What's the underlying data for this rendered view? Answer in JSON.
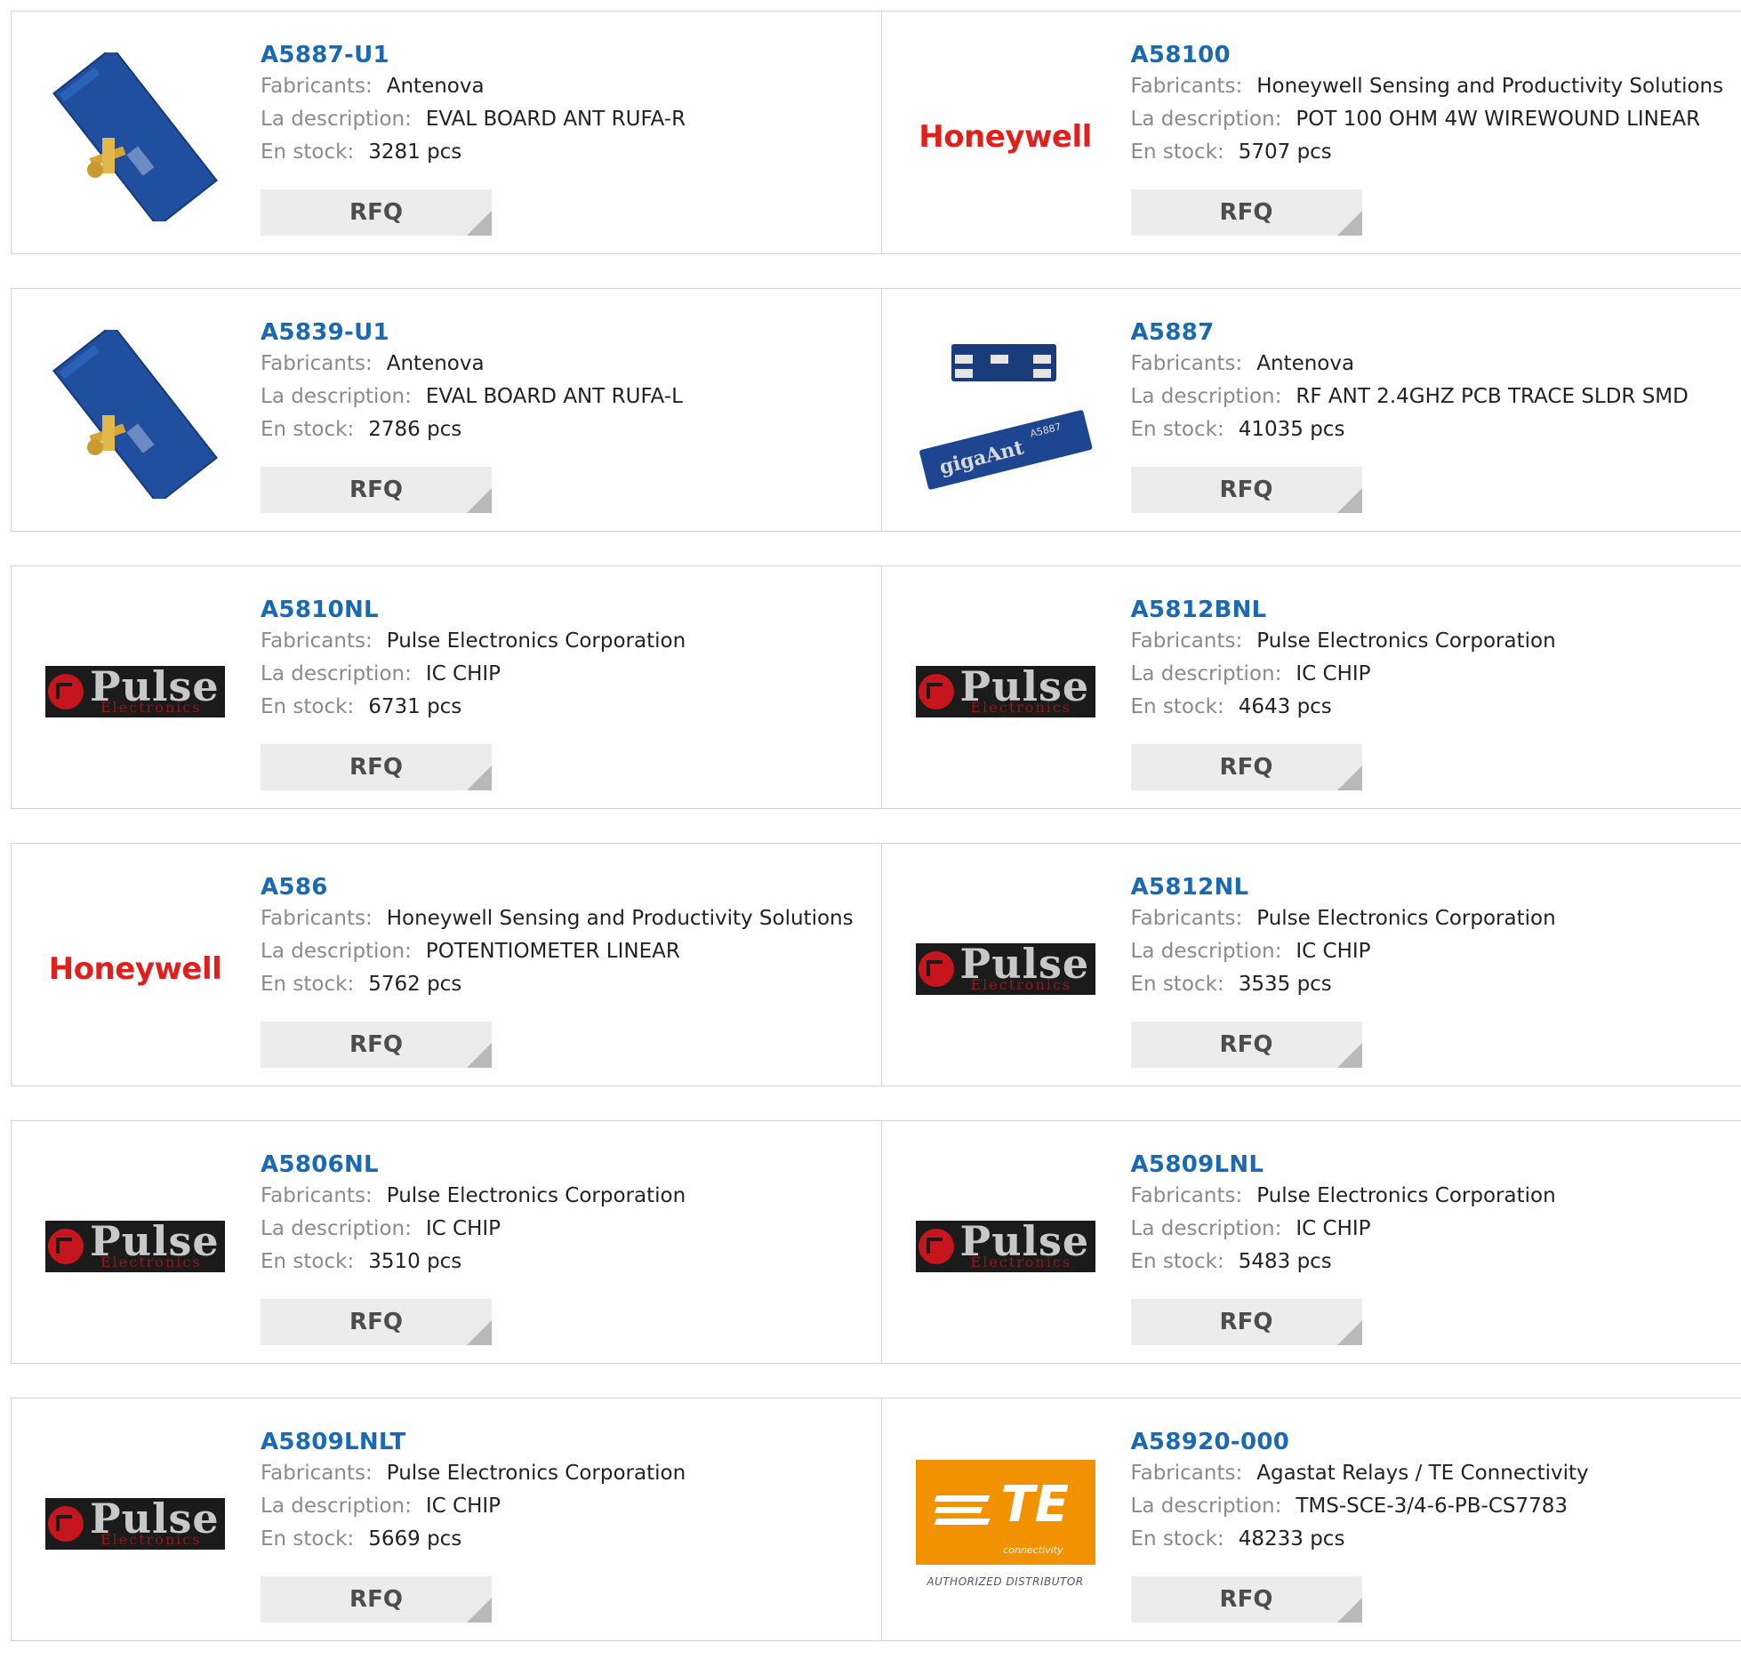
{
  "labels": {
    "manufacturer": "Fabricants:",
    "description": "La description:",
    "stock": "En stock:",
    "rfq": "RFQ"
  },
  "products": [
    {
      "pn": "A5887-U1",
      "manufacturer": "Antenova",
      "description": "EVAL BOARD ANT RUFA-R",
      "stock": "3281 pcs",
      "image": "antenova-eval-board-image"
    },
    {
      "pn": "A58100",
      "manufacturer": "Honeywell Sensing and Productivity Solutions",
      "description": "POT 100 OHM 4W WIREWOUND LINEAR",
      "stock": "5707 pcs",
      "image": "honeywell-logo",
      "logo_text": "Honeywell"
    },
    {
      "pn": "A5839-U1",
      "manufacturer": "Antenova",
      "description": "EVAL BOARD ANT RUFA-L",
      "stock": "2786 pcs",
      "image": "antenova-eval-board-image"
    },
    {
      "pn": "A5887",
      "manufacturer": "Antenova",
      "description": "RF ANT 2.4GHZ PCB TRACE SLDR SMD",
      "stock": "41035 pcs",
      "image": "gigaant-chip-antenna-image"
    },
    {
      "pn": "A5810NL",
      "manufacturer": "Pulse Electronics Corporation",
      "description": "IC CHIP",
      "stock": "6731 pcs",
      "image": "pulse-electronics-logo",
      "logo_text": "Pulse",
      "logo_sub": "Electronics"
    },
    {
      "pn": "A5812BNL",
      "manufacturer": "Pulse Electronics Corporation",
      "description": "IC CHIP",
      "stock": "4643 pcs",
      "image": "pulse-electronics-logo",
      "logo_text": "Pulse",
      "logo_sub": "Electronics"
    },
    {
      "pn": "A586",
      "manufacturer": "Honeywell Sensing and Productivity Solutions",
      "description": "POTENTIOMETER LINEAR",
      "stock": "5762 pcs",
      "image": "honeywell-logo",
      "logo_text": "Honeywell"
    },
    {
      "pn": "A5812NL",
      "manufacturer": "Pulse Electronics Corporation",
      "description": "IC CHIP",
      "stock": "3535 pcs",
      "image": "pulse-electronics-logo",
      "logo_text": "Pulse",
      "logo_sub": "Electronics"
    },
    {
      "pn": "A5806NL",
      "manufacturer": "Pulse Electronics Corporation",
      "description": "IC CHIP",
      "stock": "3510 pcs",
      "image": "pulse-electronics-logo",
      "logo_text": "Pulse",
      "logo_sub": "Electronics"
    },
    {
      "pn": "A5809LNL",
      "manufacturer": "Pulse Electronics Corporation",
      "description": "IC CHIP",
      "stock": "5483 pcs",
      "image": "pulse-electronics-logo",
      "logo_text": "Pulse",
      "logo_sub": "Electronics"
    },
    {
      "pn": "A5809LNLT",
      "manufacturer": "Pulse Electronics Corporation",
      "description": "IC CHIP",
      "stock": "5669 pcs",
      "image": "pulse-electronics-logo",
      "logo_text": "Pulse",
      "logo_sub": "Electronics"
    },
    {
      "pn": "A58920-000",
      "manufacturer": "Agastat Relays / TE Connectivity",
      "description": "TMS-SCE-3/4-6-PB-CS7783",
      "stock": "48233 pcs",
      "image": "te-connectivity-logo",
      "logo_text": "TE",
      "logo_sub": "connectivity",
      "logo_caption": "AUTHORIZED DISTRIBUTOR"
    }
  ],
  "colors": {
    "part_number": "#1a69b3",
    "label": "#8a8a8a",
    "value": "#222222",
    "rfq_bg": "#ececec",
    "border": "#d4d4d4",
    "honeywell_red": "#e0201c",
    "te_orange": "#f39200"
  }
}
